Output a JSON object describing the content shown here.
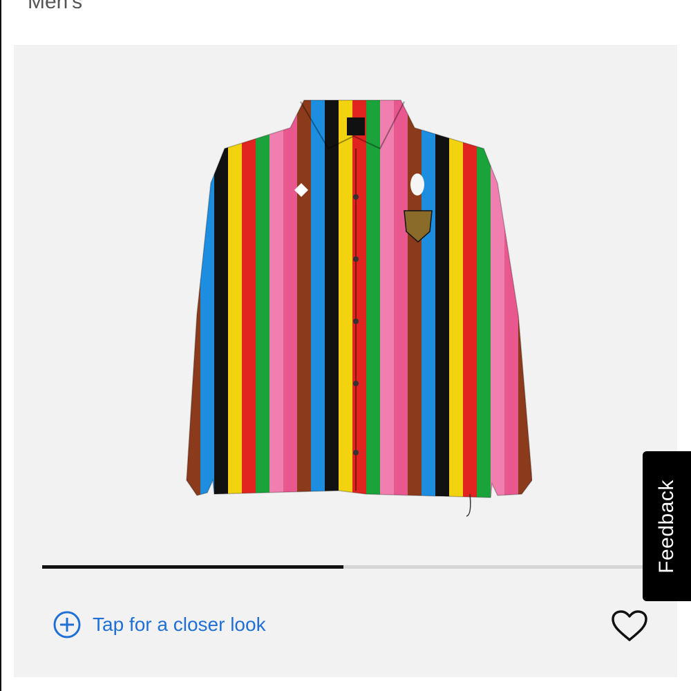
{
  "header": {
    "category": "Men's"
  },
  "gallery": {
    "image_alt": "Striped jacket",
    "progress_fraction": 0.5,
    "zoom_label": "Tap for a closer look"
  },
  "feedback": {
    "label": "Feedback"
  },
  "icons": {
    "zoom": "plus-circle-icon",
    "favorite": "heart-outline-icon"
  },
  "colors": {
    "accent": "#1f6fd6",
    "gallery_bg": "#f2f2f2",
    "progress_fill": "#111111",
    "progress_track": "#d6d6d6",
    "stripes": [
      "#e8588f",
      "#8b3a1c",
      "#1d8de0",
      "#111111",
      "#f3d20f",
      "#e0241f",
      "#1aa33a",
      "#f07fb0"
    ]
  }
}
